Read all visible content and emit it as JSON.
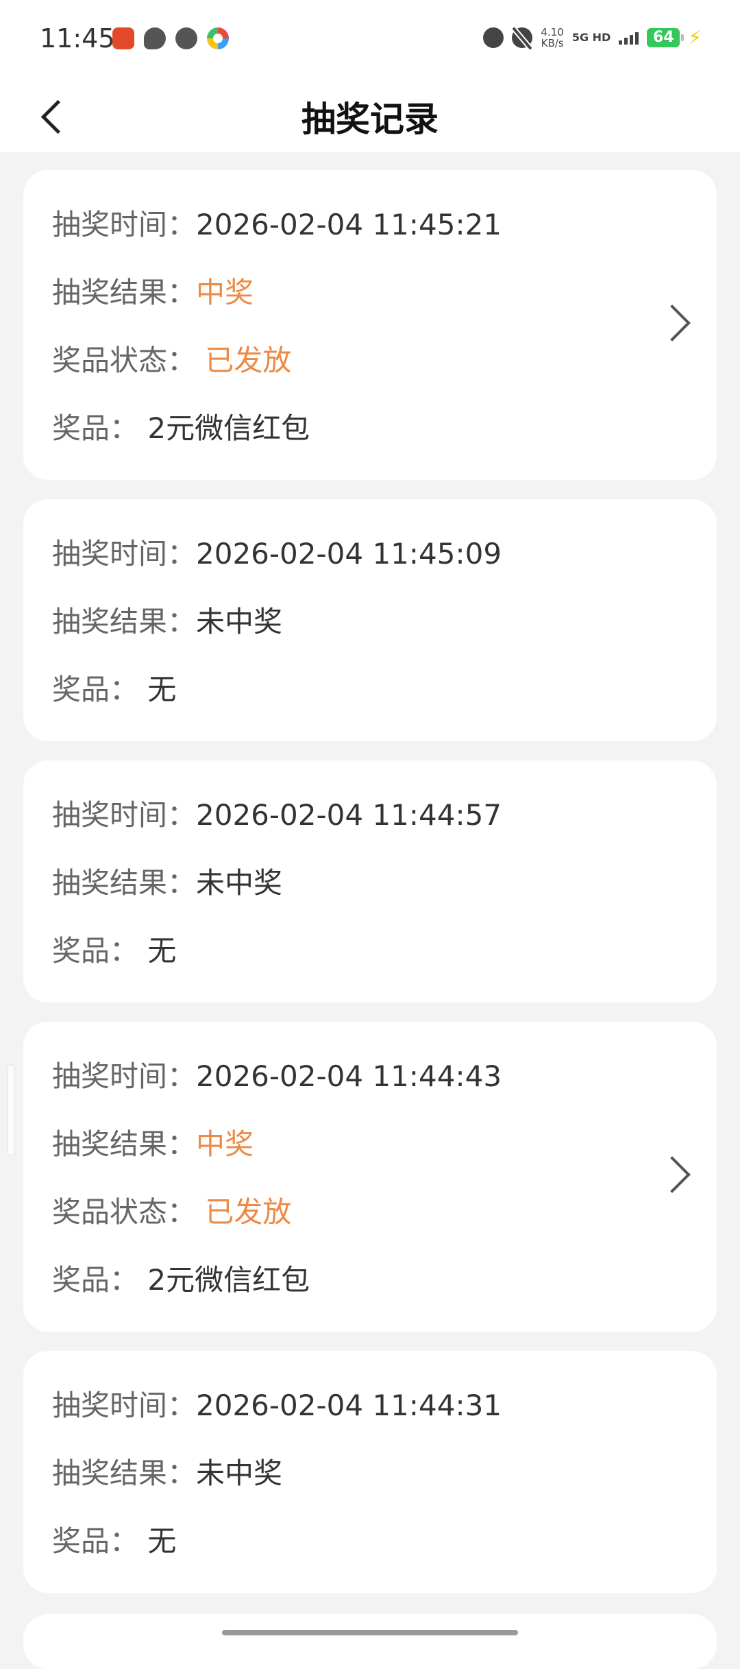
{
  "status_bar": {
    "time": "11:45",
    "left_icons": [
      "app-badge-icon",
      "chat-icon",
      "wechat-icon",
      "colorful-app-icon"
    ],
    "speed_value": "4.10",
    "speed_unit": "KB/s",
    "network": "5G HD",
    "battery": "64"
  },
  "header": {
    "title": "抽奖记录"
  },
  "labels": {
    "time": "抽奖时间：",
    "result": "抽奖结果：",
    "status": "奖品状态：",
    "prize": "奖品："
  },
  "records": [
    {
      "time": "2026-02-04 11:45:21",
      "result": "中奖",
      "status": "已发放",
      "prize": "2元微信红包"
    },
    {
      "time": "2026-02-04 11:45:09",
      "result": "未中奖",
      "prize": "无"
    },
    {
      "time": "2026-02-04 11:44:57",
      "result": "未中奖",
      "prize": "无"
    },
    {
      "time": "2026-02-04 11:44:43",
      "result": "中奖",
      "status": "已发放",
      "prize": "2元微信红包"
    },
    {
      "time": "2026-02-04 11:44:31",
      "result": "未中奖",
      "prize": "无"
    }
  ],
  "colors": {
    "highlight": "#ec8a46",
    "background": "#f3f3f3",
    "card": "#ffffff"
  }
}
